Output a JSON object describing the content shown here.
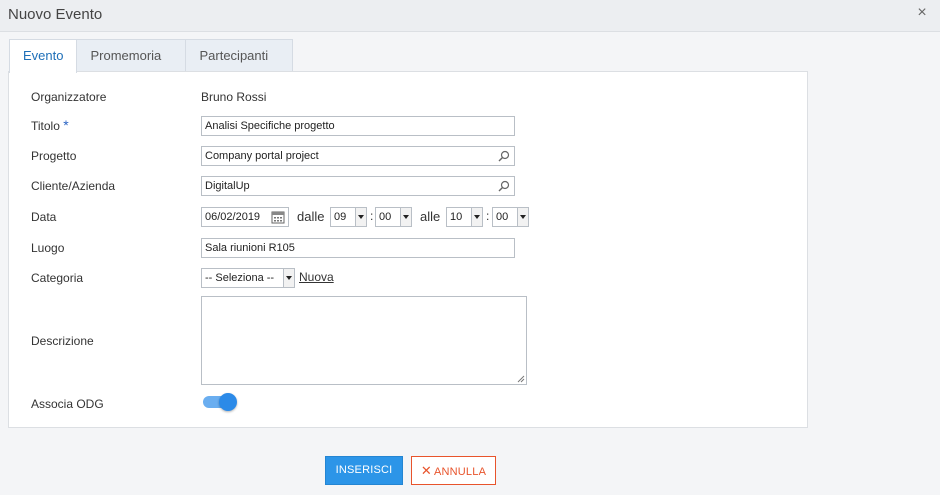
{
  "window": {
    "title": "Nuovo Evento",
    "close_icon": "×"
  },
  "tabs": [
    {
      "label": "Evento",
      "active": true
    },
    {
      "label": "Promemoria",
      "active": false
    },
    {
      "label": "Partecipanti",
      "active": false
    }
  ],
  "form": {
    "organizzatore": {
      "label": "Organizzatore",
      "value": "Bruno Rossi"
    },
    "titolo": {
      "label": "Titolo",
      "required_mark": "*",
      "value": "Analisi Specifiche progetto"
    },
    "progetto": {
      "label": "Progetto",
      "value": "Company portal project"
    },
    "cliente": {
      "label": "Cliente/Azienda",
      "value": "DigitalUp"
    },
    "data": {
      "label": "Data",
      "date": "06/02/2019",
      "dalle_label": "dalle",
      "from_hour": "09",
      "from_min": "00",
      "alle_label": "alle",
      "to_hour": "10",
      "to_min": "00",
      "colon": ":"
    },
    "luogo": {
      "label": "Luogo",
      "value": "Sala riunioni R105"
    },
    "categoria": {
      "label": "Categoria",
      "value": "-- Seleziona --",
      "new_link": "Nuova"
    },
    "descrizione": {
      "label": "Descrizione",
      "value": ""
    },
    "associa_odg": {
      "label": "Associa ODG",
      "enabled": true
    }
  },
  "buttons": {
    "insert": "INSERISCI",
    "cancel": "ANNULLA",
    "cancel_icon": "✕"
  },
  "colors": {
    "accent": "#2c95e8",
    "cancel": "#e8542c",
    "active_tab": "#1e6fb8"
  }
}
